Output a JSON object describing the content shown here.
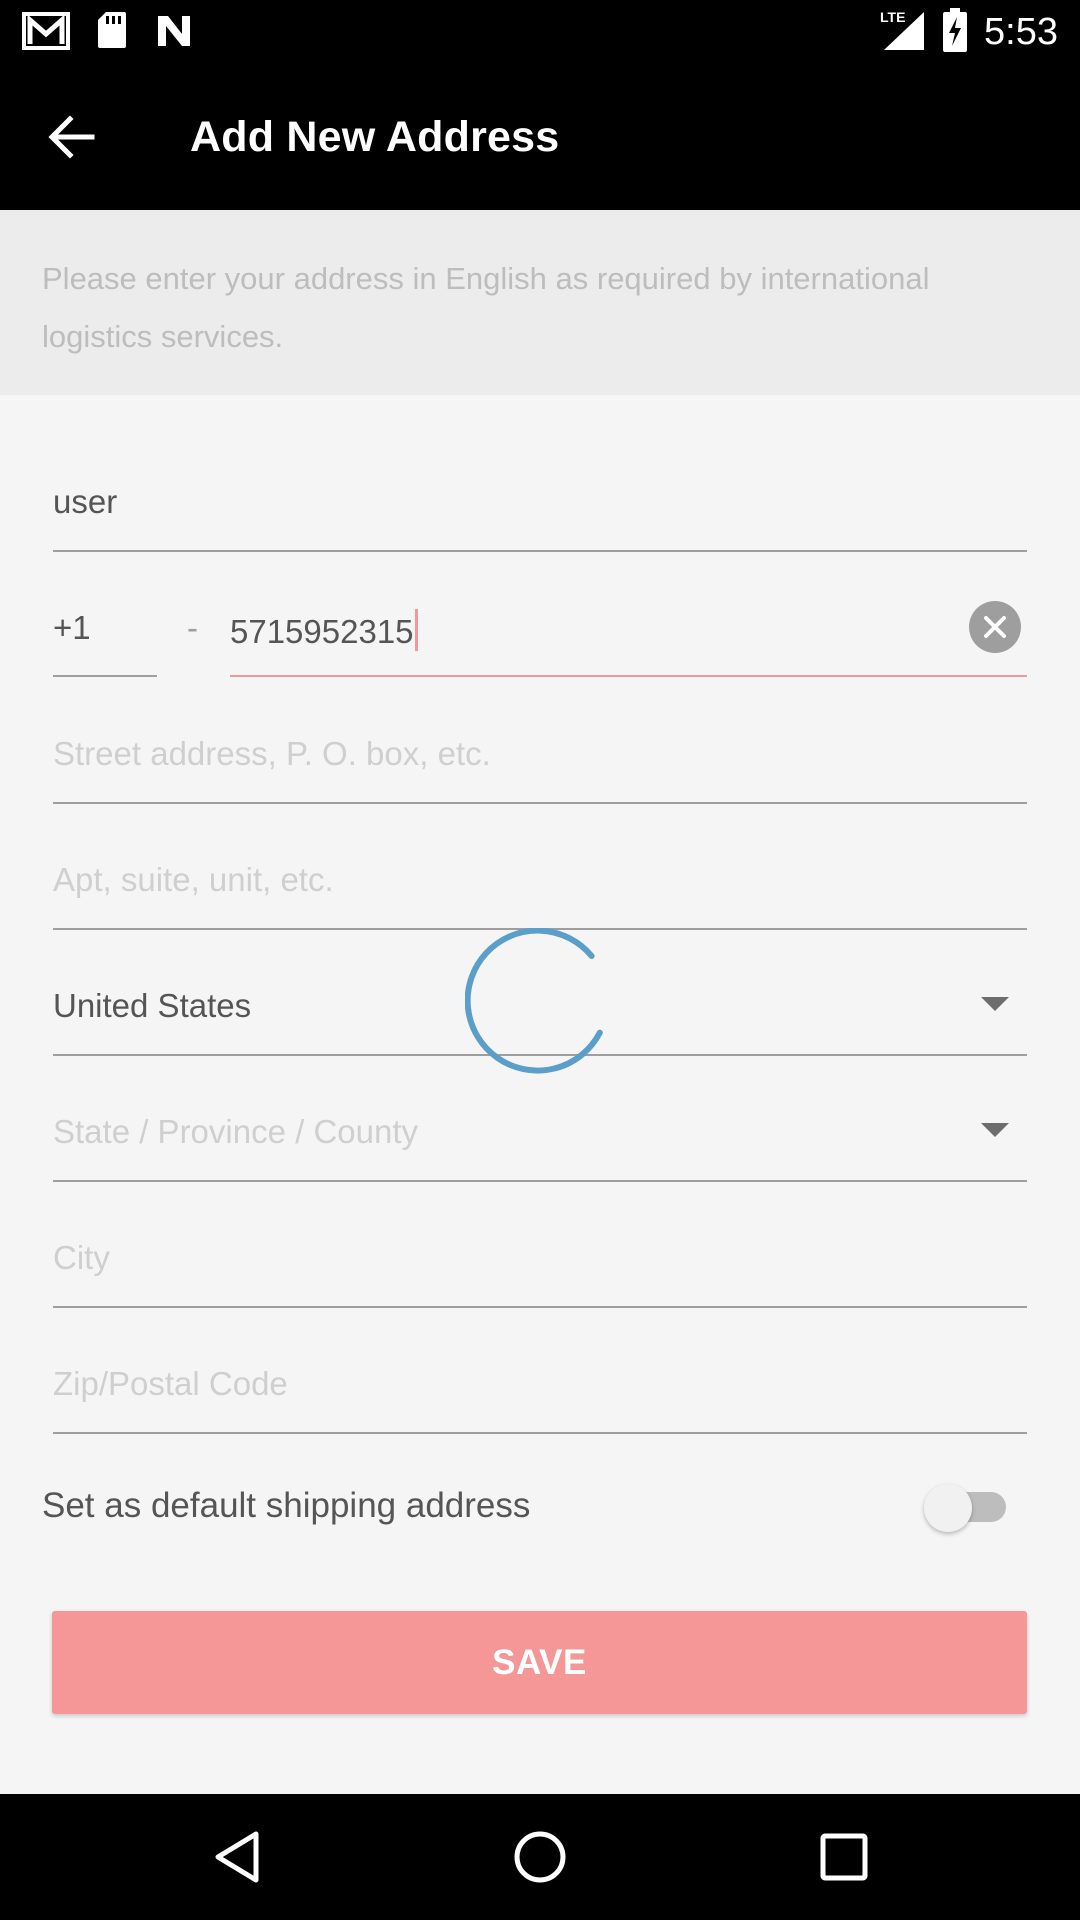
{
  "status_bar": {
    "time": "5:53",
    "network": "LTE",
    "icons": [
      "gmail-icon",
      "sd-card-icon",
      "n-icon",
      "lte-signal-icon",
      "battery-charging-icon"
    ]
  },
  "app_bar": {
    "title": "Add New Address",
    "back_icon": "arrow-back-icon"
  },
  "notice": {
    "text": "Please enter your address in English as required by international logistics services."
  },
  "form": {
    "name": {
      "value": "user"
    },
    "phone": {
      "country_code": "+1",
      "separator": "-",
      "number": "5715952315",
      "clear_icon": "clear-circle-icon"
    },
    "street": {
      "value": "",
      "placeholder": "Street address, P. O. box, etc."
    },
    "apt": {
      "value": "",
      "placeholder": "Apt, suite, unit, etc."
    },
    "country": {
      "value": "United States"
    },
    "state": {
      "value": "",
      "placeholder": "State / Province / County"
    },
    "city": {
      "value": "",
      "placeholder": "City"
    },
    "zip": {
      "value": "",
      "placeholder": "Zip/Postal Code"
    },
    "default_toggle": {
      "label": "Set as default shipping address",
      "on": false
    }
  },
  "save_button": {
    "label": "SAVE"
  },
  "colors": {
    "accent": "#f59797",
    "spinner": "#5b9ec9",
    "focus_underline": "#ef9a9a"
  },
  "nav_bar": {
    "buttons": [
      "back-triangle-icon",
      "home-circle-icon",
      "recents-square-icon"
    ]
  }
}
